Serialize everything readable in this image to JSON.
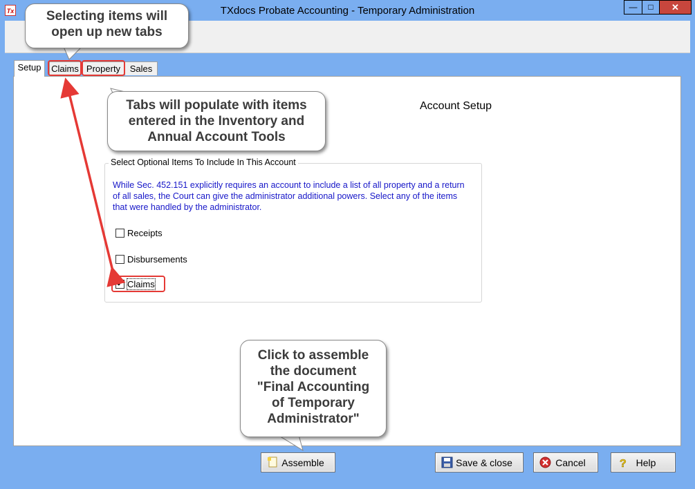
{
  "window": {
    "app_icon_text": "Tx",
    "title": "TXdocs Probate Accounting - Temporary Administration",
    "minimize_glyph": "—",
    "maximize_glyph": "□",
    "close_glyph": "✕"
  },
  "tabs": [
    {
      "label": "Setup",
      "active": true
    },
    {
      "label": "Claims",
      "active": false
    },
    {
      "label": "Property",
      "active": false
    },
    {
      "label": "Sales",
      "active": false
    }
  ],
  "setup": {
    "heading": "Account Setup",
    "group_title": "Select Optional Items To Include In This Account",
    "explanation": "While Sec. 452.151 explicitly requires an account to include a list of all property and a return of all sales, the Court can give the administrator additional powers.  Select any of the items that were handled by the administrator.",
    "options": [
      {
        "label": "Receipts",
        "checked": false
      },
      {
        "label": "Disbursements",
        "checked": false
      },
      {
        "label": "Claims",
        "checked": true
      }
    ]
  },
  "buttons": {
    "assemble": {
      "label": "Assemble",
      "icon": "document-icon"
    },
    "save_close": {
      "label": "Save & close",
      "icon": "floppy-disk-icon"
    },
    "cancel": {
      "label": "Cancel",
      "icon": "cancel-x-icon"
    },
    "help": {
      "label": "Help",
      "icon": "question-mark-icon"
    }
  },
  "callouts": {
    "tabs_open": "Selecting items will open up new tabs",
    "tabs_populate": "Tabs will populate with items entered in the Inventory and Annual Account Tools",
    "assemble_hint": "Click to assemble the document \"Final Accounting of Temporary Administrator\""
  },
  "colors": {
    "window_frame": "#7aaef0",
    "explanation_text": "#1616c8",
    "highlight": "#e53935",
    "close_button": "#c8463d"
  }
}
